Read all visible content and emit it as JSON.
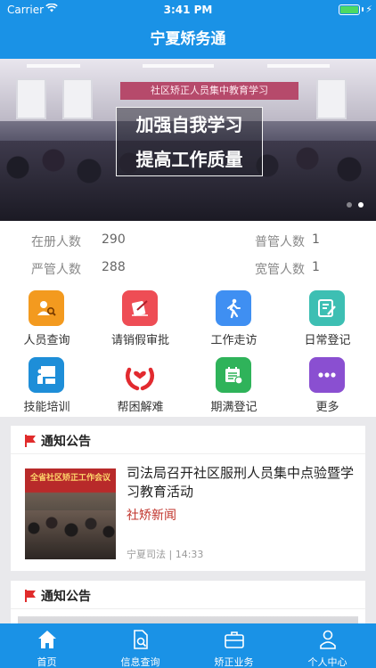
{
  "status_bar": {
    "carrier": "Carrier",
    "time": "3:41 PM"
  },
  "nav": {
    "title": "宁夏矫务通"
  },
  "banner": {
    "background_banner_text": "社区矫正人员集中教育学习",
    "slogan_line1": "加强自我学习",
    "slogan_line2": "提高工作质量",
    "page_count": 2,
    "active_page": 2
  },
  "stats": {
    "registered_label": "在册人数",
    "registered_value": "290",
    "general_label": "普管人数",
    "general_value": "1",
    "strict_label": "严管人数",
    "strict_value": "288",
    "lenient_label": "宽管人数",
    "lenient_value": "1"
  },
  "grid": {
    "items": [
      {
        "label": "人员查询",
        "color": "#f39a1f",
        "icon": "person-search-icon"
      },
      {
        "label": "请销假审批",
        "color": "#ee4d55",
        "icon": "leave-approval-icon"
      },
      {
        "label": "工作走访",
        "color": "#3f8ff2",
        "icon": "walking-icon"
      },
      {
        "label": "日常登记",
        "color": "#3dbfb3",
        "icon": "daily-register-icon"
      },
      {
        "label": "技能培训",
        "color": "#1e8ed8",
        "icon": "training-icon"
      },
      {
        "label": "帮困解难",
        "color": "#e22a2f",
        "icon": "helping-hands-icon"
      },
      {
        "label": "期满登记",
        "color": "#2fb35a",
        "icon": "calendar-icon"
      },
      {
        "label": "更多",
        "color": "#8a4fd1",
        "icon": "more-icon"
      }
    ]
  },
  "notices": [
    {
      "header": "通知公告",
      "thumb_text": "全省社区矫正工作会议",
      "title": "司法局召开社区服刑人员集中点验暨学习教育活动",
      "tag": "社矫新闻",
      "source": "宁夏司法",
      "time": "14:33"
    },
    {
      "header": "通知公告"
    }
  ],
  "colors": {
    "primary": "#1a92e6",
    "accent_red": "#c0332b"
  },
  "tabs": [
    {
      "label": "首页",
      "icon": "home-icon",
      "active": true
    },
    {
      "label": "信息查询",
      "icon": "document-search-icon"
    },
    {
      "label": "矫正业务",
      "icon": "briefcase-icon"
    },
    {
      "label": "个人中心",
      "icon": "user-icon"
    }
  ]
}
